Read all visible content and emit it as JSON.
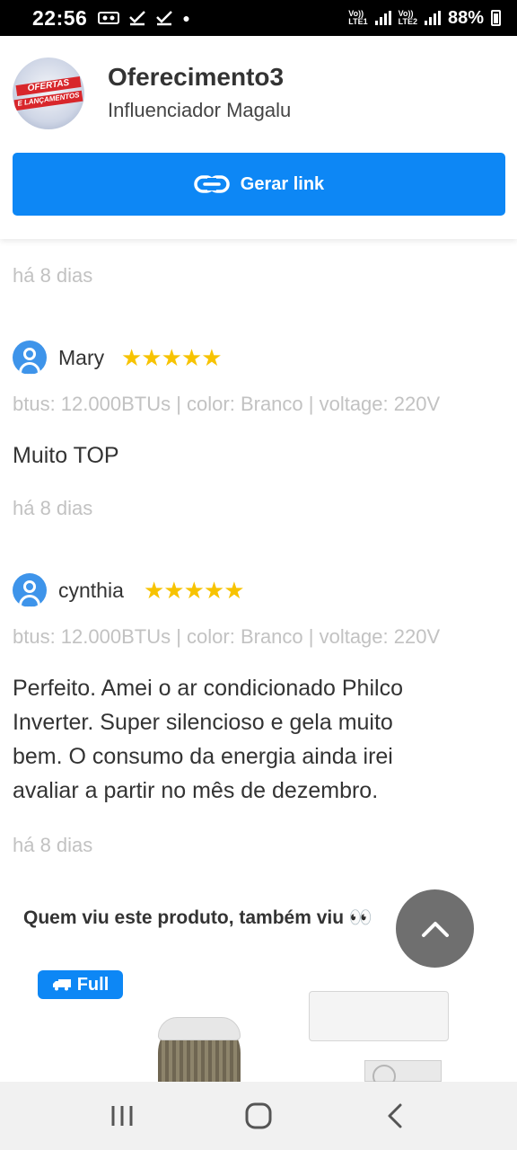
{
  "status_bar": {
    "time": "22:56",
    "sim1": [
      "Vo))",
      "LTE1"
    ],
    "sim2": [
      "Vo))",
      "LTE2"
    ],
    "battery": "88%"
  },
  "header": {
    "logo_text": [
      "OFERTAS",
      "E LANÇAMENTOS"
    ],
    "store_name": "Oferecimento3",
    "store_subtitle": "Influenciador Magalu",
    "button_label": "Gerar link"
  },
  "reviews": [
    {
      "date": "há 8 dias"
    },
    {
      "name": "Mary",
      "stars": "★★★★★",
      "variant": "btus: 12.000BTUs | color: Branco | voltage: 220V",
      "text": "Muito TOP",
      "date": "há 8 dias"
    },
    {
      "name": "cynthia",
      "stars": "★★★★★",
      "variant": "btus: 12.000BTUs | color: Branco | voltage: 220V",
      "text_lines": [
        "Perfeito. Amei o ar condicionado Philco",
        "Inverter. Super silencioso e gela muito",
        "bem. O consumo da energia ainda irei",
        "avaliar a partir no mês de dezembro."
      ],
      "date": "há 8 dias"
    }
  ],
  "also_viewed": {
    "title": "Quem viu este produto, também viu 👀",
    "badge": "Full"
  },
  "colors": {
    "accent": "#0d87f5",
    "star": "#f7c300",
    "muted": "#c2c2c2"
  }
}
